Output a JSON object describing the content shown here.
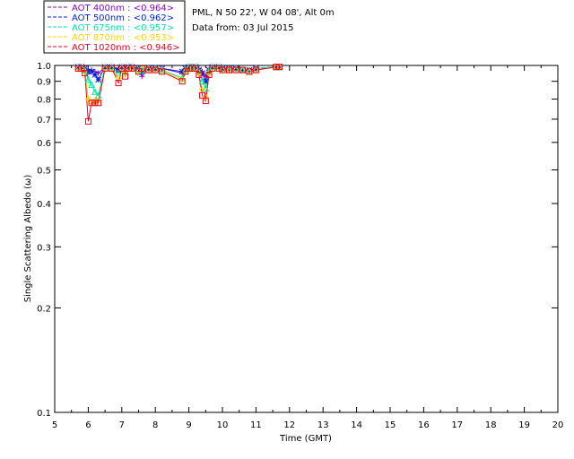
{
  "chart_data": {
    "type": "line",
    "info_lines": [
      "PML, N 50 22', W 04 08', Alt 0m",
      "Data from: 03 Jul 2015"
    ],
    "xlabel": "Time (GMT)",
    "ylabel": "Single Scattering Albedo (ω)",
    "xlim": [
      5,
      20
    ],
    "ylim": [
      0.1,
      1.0
    ],
    "y_scale": "log",
    "x_ticks": [
      "5",
      "6",
      "7",
      "8",
      "9",
      "10",
      "11",
      "12",
      "13",
      "14",
      "15",
      "16",
      "17",
      "18",
      "19",
      "20"
    ],
    "y_ticks": [
      {
        "v": 1.0,
        "label": "1.0"
      },
      {
        "v": 0.9,
        "label": "0.9"
      },
      {
        "v": 0.8,
        "label": "0.8"
      },
      {
        "v": 0.7,
        "label": "0.7"
      },
      {
        "v": 0.6,
        "label": "0.6"
      },
      {
        "v": 0.5,
        "label": "0.5"
      },
      {
        "v": 0.4,
        "label": "0.4"
      },
      {
        "v": 0.3,
        "label": "0.3"
      },
      {
        "v": 0.2,
        "label": "0.2"
      },
      {
        "v": 0.1,
        "label": "0.1"
      }
    ],
    "legend_position": "top-left, above plot",
    "x": [
      5.7,
      5.8,
      5.9,
      6.0,
      6.1,
      6.2,
      6.3,
      6.5,
      6.7,
      6.9,
      7.0,
      7.1,
      7.2,
      7.3,
      7.5,
      7.6,
      7.8,
      8.0,
      8.2,
      8.8,
      8.9,
      9.0,
      9.1,
      9.2,
      9.3,
      9.4,
      9.5,
      9.6,
      9.7,
      9.9,
      10.0,
      10.2,
      10.4,
      10.6,
      10.8,
      11.0,
      11.6,
      11.7
    ],
    "series": [
      {
        "name": "AOT  400nm : <0.964>",
        "color": "#8b00cc",
        "marker": "plus",
        "values": [
          0.99,
          0.99,
          0.98,
          0.97,
          0.97,
          0.96,
          0.95,
          0.99,
          0.99,
          0.98,
          0.99,
          0.98,
          0.99,
          0.99,
          0.98,
          0.93,
          0.98,
          0.98,
          0.98,
          0.95,
          0.97,
          0.99,
          0.99,
          0.99,
          0.98,
          0.96,
          0.93,
          0.97,
          0.99,
          0.99,
          0.98,
          0.97,
          0.98,
          0.97,
          0.96,
          0.98,
          0.99,
          0.99
        ]
      },
      {
        "name": "AOT  500nm : <0.962>",
        "color": "#0022dd",
        "marker": "star",
        "values": [
          0.99,
          0.99,
          0.98,
          0.96,
          0.96,
          0.94,
          0.91,
          0.99,
          0.99,
          0.97,
          0.99,
          0.97,
          0.99,
          0.99,
          0.98,
          0.96,
          0.98,
          0.98,
          0.98,
          0.96,
          0.98,
          0.99,
          0.99,
          0.99,
          0.97,
          0.95,
          0.9,
          0.97,
          0.99,
          0.99,
          0.98,
          0.98,
          0.98,
          0.97,
          0.97,
          0.98,
          0.99,
          0.99
        ]
      },
      {
        "name": "AOT  675nm : <0.957>",
        "color": "#00e5a8",
        "marker": "triangle",
        "values": [
          0.99,
          0.99,
          0.97,
          0.91,
          0.88,
          0.84,
          0.82,
          0.99,
          0.99,
          0.95,
          0.99,
          0.96,
          0.99,
          0.99,
          0.97,
          0.97,
          0.98,
          0.98,
          0.97,
          0.92,
          0.97,
          0.99,
          0.99,
          0.99,
          0.96,
          0.9,
          0.86,
          0.96,
          0.99,
          0.99,
          0.98,
          0.97,
          0.98,
          0.97,
          0.96,
          0.98,
          0.99,
          0.99
        ]
      },
      {
        "name": "AOT  870nm : <0.953>",
        "color": "#ffd400",
        "marker": "diamond",
        "values": [
          0.98,
          0.98,
          0.96,
          0.8,
          0.78,
          0.79,
          0.79,
          0.98,
          0.98,
          0.92,
          0.98,
          0.95,
          0.98,
          0.98,
          0.96,
          0.98,
          0.97,
          0.97,
          0.97,
          0.91,
          0.96,
          0.98,
          0.98,
          0.98,
          0.95,
          0.85,
          0.81,
          0.95,
          0.98,
          0.98,
          0.97,
          0.97,
          0.97,
          0.97,
          0.96,
          0.97,
          0.99,
          0.99
        ]
      },
      {
        "name": "AOT 1020nm : <0.946>",
        "color": "#e8001c",
        "marker": "square",
        "values": [
          0.98,
          0.98,
          0.95,
          0.69,
          0.78,
          0.78,
          0.78,
          0.98,
          0.98,
          0.89,
          0.98,
          0.93,
          0.98,
          0.98,
          0.96,
          0.98,
          0.97,
          0.97,
          0.96,
          0.9,
          0.96,
          0.98,
          0.98,
          0.98,
          0.94,
          0.82,
          0.79,
          0.94,
          0.98,
          0.98,
          0.97,
          0.97,
          0.97,
          0.97,
          0.96,
          0.97,
          0.99,
          0.99
        ]
      }
    ]
  }
}
